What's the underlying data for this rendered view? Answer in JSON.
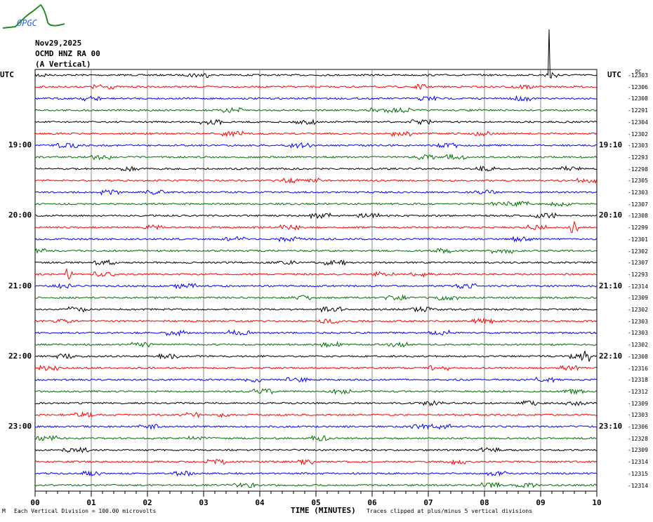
{
  "logo_text": "OPGC",
  "header": {
    "date": "Nov29,2025",
    "station": "OCMD HNZ RA 00",
    "component": "(A Vertical)"
  },
  "left_labels": [
    "UTC",
    "",
    "",
    "",
    "",
    "",
    "19:00",
    "",
    "",
    "",
    "",
    "",
    "20:00",
    "",
    "",
    "",
    "",
    "",
    "21:00",
    "",
    "",
    "",
    "",
    "",
    "22:00",
    "",
    "",
    "",
    "",
    "",
    "23:00",
    "",
    "",
    "",
    "",
    ""
  ],
  "right_labels": [
    "UTC",
    "",
    "",
    "",
    "",
    "",
    "19:10",
    "",
    "",
    "",
    "",
    "",
    "20:10",
    "",
    "",
    "",
    "",
    "",
    "21:10",
    "",
    "",
    "",
    "",
    "",
    "22:10",
    "",
    "",
    "",
    "",
    "",
    "23:10",
    "",
    "",
    "",
    "",
    ""
  ],
  "dc_label": "DC",
  "dc_offsets": [
    "-12303",
    "-12306",
    "-12308",
    "-12291",
    "-12304",
    "-12302",
    "-12303",
    "-12293",
    "-12298",
    "-12305",
    "-12303",
    "-12307",
    "-12308",
    "-12299",
    "-12301",
    "-12302",
    "-12307",
    "-12293",
    "-12314",
    "-12309",
    "-12302",
    "-12303",
    "-12303",
    "-12302",
    "-12308",
    "-12316",
    "-12318",
    "-12312",
    "-12309",
    "-12303",
    "-12306",
    "-12328",
    "-12309",
    "-12314",
    "-12315",
    "-12314"
  ],
  "footer": {
    "scale": "Each Vertical Division =  100.00 microvolts",
    "clip": "Traces clipped at plus/minus 5 vertical divisions",
    "corner": "M"
  },
  "colors": [
    "#000000",
    "#ff0000",
    "#0000ff",
    "#007000"
  ],
  "chart_data": {
    "type": "line",
    "title": "OCMD HNZ RA 00 helicorder",
    "xlabel": "TIME (MINUTES)",
    "x_ticks": [
      "00",
      "01",
      "02",
      "03",
      "04",
      "05",
      "06",
      "07",
      "08",
      "09",
      "10"
    ],
    "xlim": [
      0,
      10
    ],
    "rows": 36,
    "row_minutes": 10,
    "start_utc": "18:00",
    "events": [
      {
        "row": 0,
        "minute": 9.15,
        "note": "large spike clipped"
      },
      {
        "row": 13,
        "minute": 9.6
      },
      {
        "row": 17,
        "minute": 0.6
      },
      {
        "row": 24,
        "minute": 9.8
      }
    ]
  }
}
